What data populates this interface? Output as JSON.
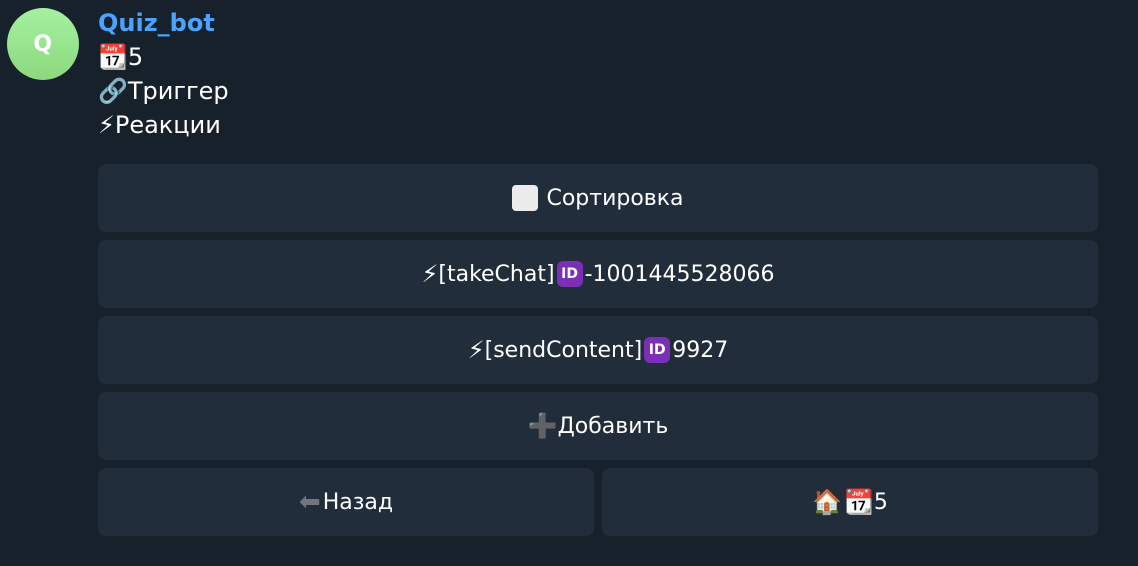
{
  "avatar": {
    "letter": "Q"
  },
  "message": {
    "sender": "Quiz_bot",
    "lines": [
      {
        "emoji": "📆",
        "text": "5"
      },
      {
        "emoji": "🔗",
        "text": "Триггер"
      },
      {
        "emoji": "⚡",
        "text": "Реакции"
      }
    ]
  },
  "keyboard": {
    "row1": {
      "label": "Сортировка"
    },
    "row2": {
      "prefix": "⚡",
      "label": "[takeChat]",
      "id_badge": "ID",
      "value": "-1001445528066"
    },
    "row3": {
      "prefix": "⚡",
      "label": "[sendContent]",
      "id_badge": "ID",
      "value": "9927"
    },
    "row4": {
      "prefix": "➕",
      "label": "Добавить"
    },
    "row5": {
      "back": {
        "arrow": "⬅",
        "label": "Назад"
      },
      "home": {
        "icon_house": "🏠",
        "icon_calendar": "📆",
        "label": "5"
      }
    }
  },
  "colors": {
    "background": "#17212b",
    "button_bg": "#212d3b",
    "sender_color": "#4aa3ff",
    "avatar_gradient_top": "#a5f0a0",
    "avatar_gradient_bottom": "#8cd97f",
    "id_badge": "#7b2fb6"
  },
  "icons": {
    "calendar": "calendar-icon",
    "link": "link-icon",
    "lightning": "lightning-icon",
    "plus": "plus-icon",
    "back": "back-arrow-icon",
    "home": "house-icon",
    "square": "white-square-icon",
    "id": "id-badge-icon"
  }
}
